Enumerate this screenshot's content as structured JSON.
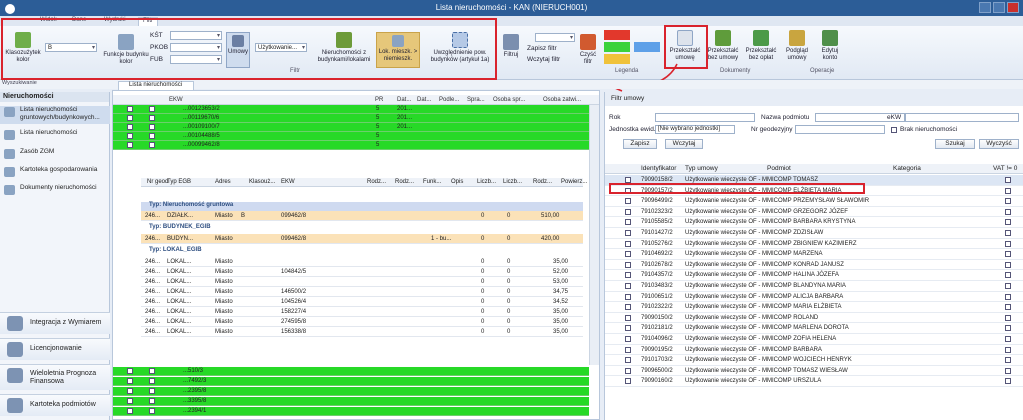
{
  "window": {
    "title": "Lista nieruchomości - KAN (NIERUCH001)"
  },
  "menu": {
    "tabs": [
      "Widok",
      "Dane",
      "Wydruki",
      "Filtr"
    ],
    "active": "Filtr"
  },
  "ribbon": {
    "klasoz": "Klasozużytek kolor",
    "b_value": "B",
    "funkcje": "Funkcje budynku kolor",
    "kst": "KŚT",
    "pkob": "PKOB",
    "fub": "FUB",
    "umowy": "Umowy",
    "uzytk": "Użytkowanie...",
    "nier_bud": "Nieruchomości z budynkami/lokalami",
    "lok_miesz": "Lok. mieszk. > niemieszk.",
    "uwzgl": "Uwzględnienie pow. budynków (artykuł 1a)",
    "filtr_group": "Filtr",
    "filtruj": "Filtruj",
    "zapisz_filtr": "Zapisz filtr",
    "wczytaj_filtr": "Wczytaj filtr",
    "czysc_filtr": "Czyść filtr",
    "legenda": "Legenda",
    "przeksztalc_umowe": "Przekształć umowę",
    "bez_umowy": "Przekształć bez umowy",
    "bez_oplat": "Przekształć bez opłat",
    "podglad": "Podgląd umowy",
    "edytuj": "Edytuj konto",
    "dokumenty": "Dokumenty",
    "operacje": "Operacje"
  },
  "search_label": "Wyszukiwanie",
  "leftnav": {
    "header": "Nieruchomości",
    "items": [
      "Lista nieruchomości gruntowych/budynkowych...",
      "Lista nieruchomości",
      "Zasób ZGM",
      "Kartoteka gospodarowania",
      "Dokumenty nieruchomości"
    ],
    "big": [
      "Integracja z Wymiarem",
      "Licencjonowanie",
      "Wieloletnia Prognoza Finansowa",
      "Kartoteka podmiotów"
    ]
  },
  "center": {
    "tab": "Lista nieruchomości",
    "headers": [
      "EKW",
      "PR",
      "Dat...",
      "Dat...",
      "Podle...",
      "Spra...",
      "Osoba spr...",
      "Osoba zatwi..."
    ],
    "top_rows": [
      [
        "...00123653/2",
        "5",
        "201..."
      ],
      [
        "...00119670/6",
        "5",
        "201..."
      ],
      [
        "...00109100/7",
        "5",
        "201..."
      ],
      [
        "...00104488/5",
        "5",
        ""
      ],
      [
        "...00099462/8",
        "5",
        ""
      ]
    ],
    "sub_headers": [
      "Nr geod",
      "Typ EGB",
      "Adres",
      "Klasouż...",
      "EKW",
      "Rodz...",
      "Rodz...",
      "Funk...",
      "Opis",
      "Liczb...",
      "Liczb...",
      "Rodz...",
      "Powierz..."
    ],
    "groups": [
      "Typ: Nieruchomość gruntowa",
      "Typ: BUDYNEK_EGIB",
      "Typ: LOKAL_EGIB"
    ],
    "grunt_row": [
      "246...",
      "DZIAŁK...",
      "Miasto",
      "B",
      "099462/8",
      "0",
      "0",
      "510,00"
    ],
    "bud_row": [
      "246...",
      "BUDYN...",
      "Miasto",
      "099462/8",
      "1 - bu...",
      "0",
      "0",
      "420,00"
    ],
    "lokal_rows": [
      [
        "246...",
        "LOKAL...",
        "Miasto",
        "",
        "0",
        "0",
        "35,00"
      ],
      [
        "246...",
        "LOKAL...",
        "Miasto",
        "104842/5",
        "0",
        "0",
        "52,00"
      ],
      [
        "246...",
        "LOKAL...",
        "Miasto",
        "",
        "0",
        "0",
        "53,00"
      ],
      [
        "246...",
        "LOKAL...",
        "Miasto",
        "146500/2",
        "0",
        "0",
        "34,75"
      ],
      [
        "246...",
        "LOKAL...",
        "Miasto",
        "104526/4",
        "0",
        "0",
        "34,52"
      ],
      [
        "246...",
        "LOKAL...",
        "Miasto",
        "158227/4",
        "0",
        "0",
        "35,00"
      ],
      [
        "246...",
        "LOKAL...",
        "Miasto",
        "274595/8",
        "0",
        "0",
        "35,00"
      ],
      [
        "246...",
        "LOKAL...",
        "Miasto",
        "156338/8",
        "0",
        "0",
        "35,00"
      ]
    ],
    "bottom_rows": [
      "...510/3",
      "...7492/3",
      "...2395/8",
      "...3395/8",
      "...2394/1"
    ]
  },
  "right": {
    "filter_title": "Filtr umowy",
    "rok": "Rok",
    "nazwa": "Nazwa podmiotu",
    "ekw": "eKW",
    "jednostka": "Jednostka ewid.",
    "jednostka_val": "[Nie wybrano jednostki]",
    "nr_geod": "Nr geodezyjny",
    "brak": "Brak nieruchomości",
    "zapisz": "Zapisz",
    "wczytaj": "Wczytaj",
    "szukaj": "Szukaj",
    "wyczysc": "Wyczyść",
    "headers": [
      "Identyfikator",
      "Typ umowy",
      "Podmiot",
      "Kategoria",
      "VAT != 0"
    ],
    "rows": [
      [
        "79090158/2",
        "Użytkowanie wieczyste OF - M",
        "MICOMP TOMASZ"
      ],
      [
        "79090157/2",
        "Użytkowanie wieczyste OF - M",
        "MICOMP ELŻBIETA MARIA"
      ],
      [
        "79096499/2",
        "Użytkowanie wieczyste OF - M",
        "MICOMP PRZEMYSŁAW SŁAWOMIR"
      ],
      [
        "79102323/2",
        "Użytkowanie wieczyste OF - M",
        "MICOMP GRZEGORZ JÓZEF"
      ],
      [
        "79105585/2",
        "Użytkowanie wieczyste OF - M",
        "MICOMP BARBARA KRYSTYNA"
      ],
      [
        "79101427/2",
        "Użytkowanie wieczyste OF - M",
        "MICOMP ZDZISŁAW"
      ],
      [
        "79105276/2",
        "Użytkowanie wieczyste OF - M",
        "MICOMP ZBIGNIEW KAZIMIERZ"
      ],
      [
        "79104692/2",
        "Użytkowanie wieczyste OF - M",
        "MICOMP MARZENA"
      ],
      [
        "79102678/2",
        "Użytkowanie wieczyste OF - M",
        "MICOMP KONRAD JANUSZ"
      ],
      [
        "79104357/2",
        "Użytkowanie wieczyste OF - M",
        "MICOMP HALINA JÓZEFA"
      ],
      [
        "79103483/2",
        "Użytkowanie wieczyste OF - M",
        "MICOMP BLANDYNA MARIA"
      ],
      [
        "79100651/2",
        "Użytkowanie wieczyste OF - M",
        "MICOMP ALICJA BARBARA"
      ],
      [
        "79102322/2",
        "Użytkowanie wieczyste OF - M",
        "MICOMP MARIA ELŻBIETA"
      ],
      [
        "79090150/2",
        "Użytkowanie wieczyste OF - M",
        "MICOMP ROLAND"
      ],
      [
        "79102181/2",
        "Użytkowanie wieczyste OF - M",
        "MICOMP MARLENA DOROTA"
      ],
      [
        "79104096/2",
        "Użytkowanie wieczyste OF - M",
        "MICOMP ZOFIA HELENA"
      ],
      [
        "79090195/2",
        "Użytkowanie wieczyste OF - M",
        "MICOMP BARBARA"
      ],
      [
        "79101703/2",
        "Użytkowanie wieczyste OF - M",
        "MICOMP WOJCIECH HENRYK"
      ],
      [
        "79096500/2",
        "Użytkowanie wieczyste OF - M",
        "MICOMP TOMASZ WIESŁAW"
      ],
      [
        "79090160/2",
        "Użytkowanie wieczyste OF - M",
        "MICOMP URSZULA"
      ]
    ]
  }
}
